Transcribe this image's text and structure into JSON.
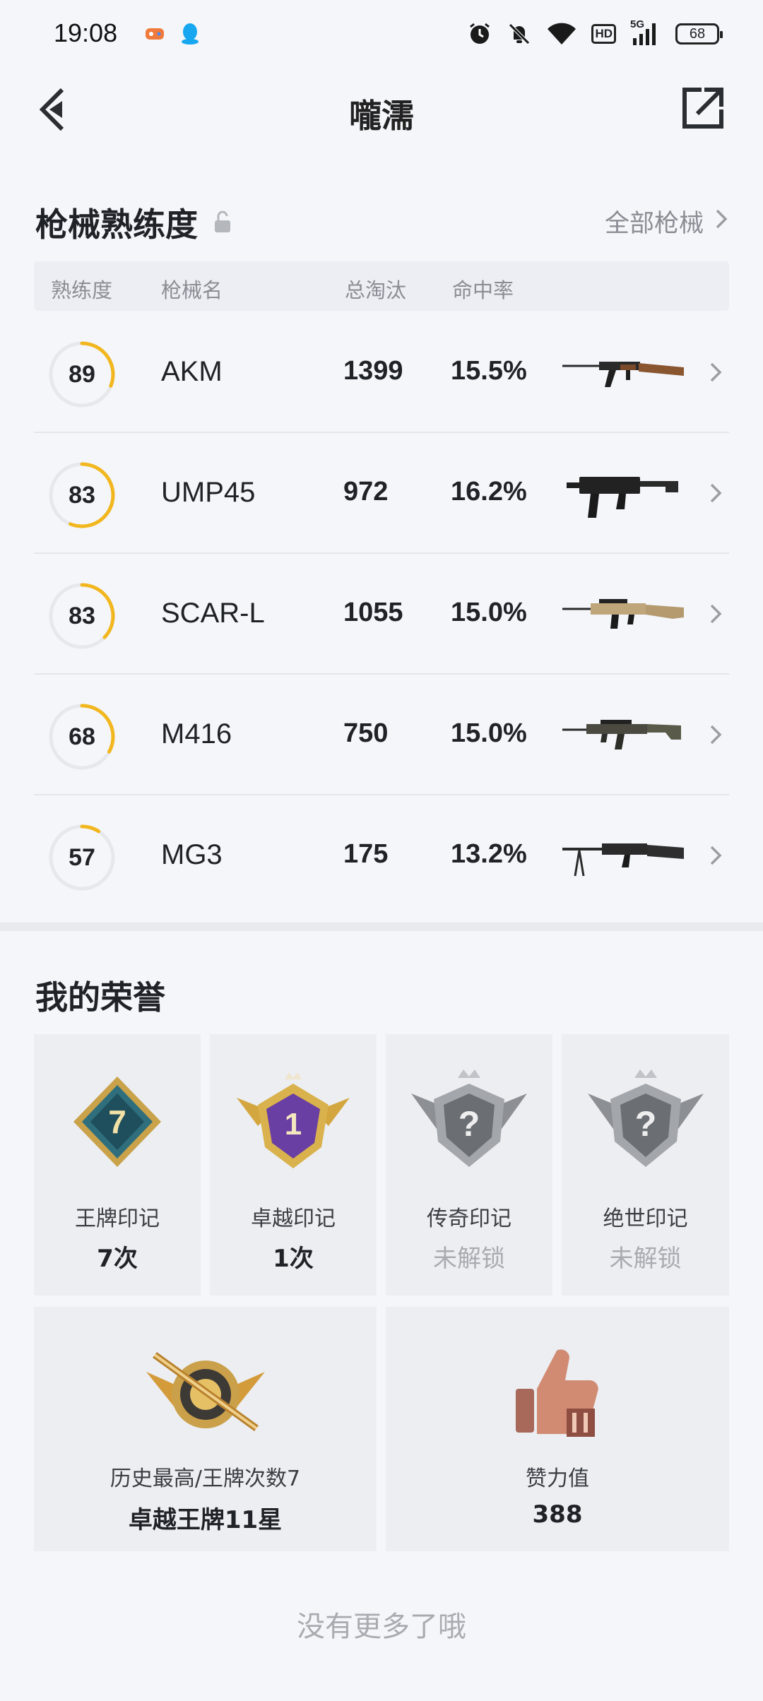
{
  "status_bar": {
    "time": "19:08",
    "battery": "68",
    "hd_label": "HD",
    "network_label": "5G",
    "icons": [
      "game-icon",
      "qq-icon",
      "alarm-icon",
      "mute-icon",
      "wifi-icon",
      "hd-icon",
      "signal-icon",
      "battery-icon"
    ]
  },
  "header": {
    "title": "嚨濡",
    "back_icon": "chevron-left-icon",
    "share_icon": "share-icon"
  },
  "weapons": {
    "title": "枪械熟练度",
    "all_label": "全部枪械",
    "columns": {
      "proficiency": "熟练度",
      "name": "枪械名",
      "kills": "总淘汰",
      "accuracy": "命中率"
    },
    "rows": [
      {
        "proficiency": "89",
        "name": "AKM",
        "kills": "1399",
        "accuracy": "15.5%",
        "ring_fraction": 0.31,
        "gun": "akm"
      },
      {
        "proficiency": "83",
        "name": "UMP45",
        "kills": "972",
        "accuracy": "16.2%",
        "ring_fraction": 0.56,
        "gun": "ump45"
      },
      {
        "proficiency": "83",
        "name": "SCAR-L",
        "kills": "1055",
        "accuracy": "15.0%",
        "ring_fraction": 0.37,
        "gun": "scar"
      },
      {
        "proficiency": "68",
        "name": "M416",
        "kills": "750",
        "accuracy": "15.0%",
        "ring_fraction": 0.33,
        "gun": "m416"
      },
      {
        "proficiency": "57",
        "name": "MG3",
        "kills": "175",
        "accuracy": "13.2%",
        "ring_fraction": 0.09,
        "gun": "mg3"
      }
    ],
    "colors": {
      "ring": "#f2b71e",
      "track": "#e6e8ec"
    }
  },
  "honors": {
    "title": "我的荣誉",
    "badges": [
      {
        "label": "王牌印记",
        "value": "7次",
        "locked": false,
        "emblem_text": "7"
      },
      {
        "label": "卓越印记",
        "value": "1次",
        "locked": false,
        "emblem_text": "1"
      },
      {
        "label": "传奇印记",
        "value": "未解锁",
        "locked": true,
        "emblem_text": "?"
      },
      {
        "label": "绝世印记",
        "value": "未解锁",
        "locked": true,
        "emblem_text": "?"
      }
    ],
    "history": {
      "label": "历史最高/王牌次数7",
      "value": "卓越王牌11星"
    },
    "likes": {
      "label": "赞力值",
      "value": "388"
    }
  },
  "footer": {
    "no_more": "没有更多了哦"
  }
}
